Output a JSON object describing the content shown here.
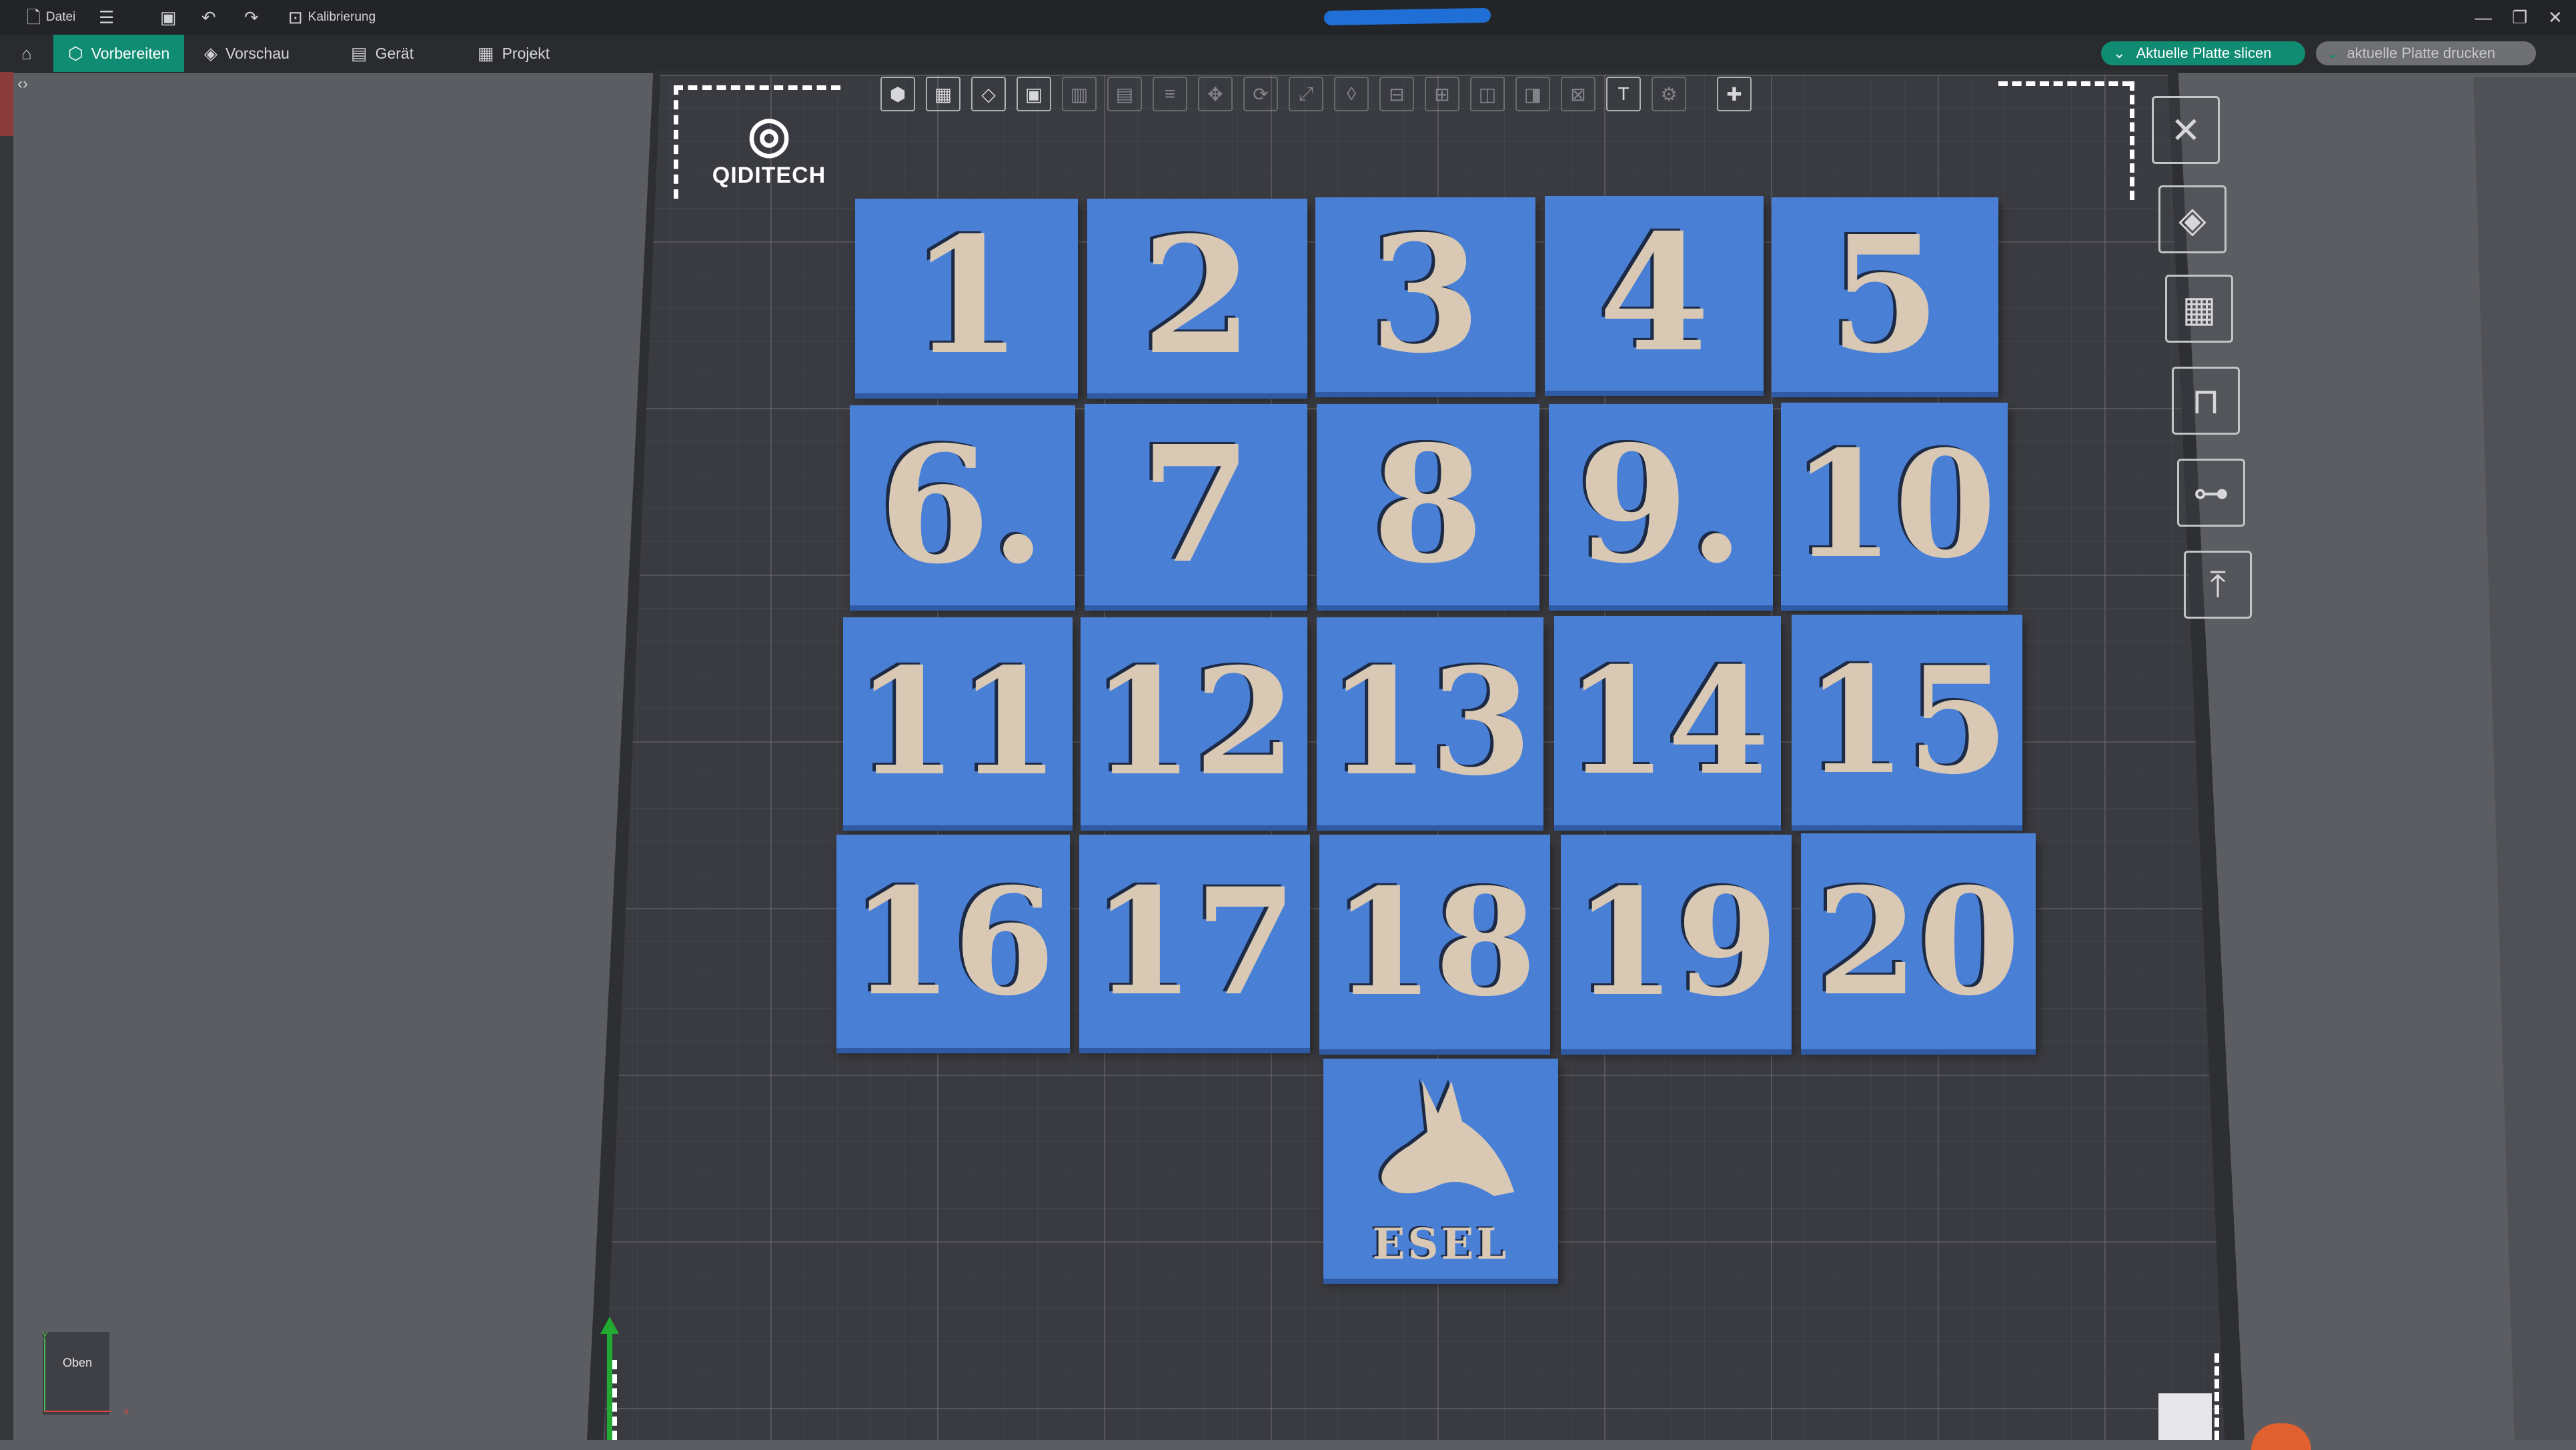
{
  "titlebar": {
    "file_label": "Datei",
    "calibration_label": "Kalibrierung",
    "icons": [
      "file-icon",
      "list-icon",
      "save-icon",
      "undo-icon",
      "redo-icon",
      "calibration-icon"
    ],
    "window_controls": [
      "minimize-icon",
      "restore-icon",
      "close-icon"
    ]
  },
  "menubar": {
    "tabs": [
      {
        "label": "Vorbereiten",
        "icon": "cube-icon",
        "active": true
      },
      {
        "label": "Vorschau",
        "icon": "layers-icon",
        "active": false
      },
      {
        "label": "Gerät",
        "icon": "device-icon",
        "active": false
      },
      {
        "label": "Projekt",
        "icon": "project-icon",
        "active": false
      }
    ],
    "slice_button": "Aktuelle Platte slicen",
    "print_button": "aktuelle Platte drucken"
  },
  "plate": {
    "logo_text": "QIDITECH",
    "tiles": [
      "1",
      "2",
      "3",
      "4",
      "5",
      "6.",
      "7",
      "8",
      "9.",
      "10",
      "11",
      "12",
      "13",
      "14",
      "15",
      "16",
      "17",
      "18",
      "19",
      "20"
    ],
    "esel_label": "ESEL"
  },
  "navcube": {
    "face_label": "Oben",
    "axis_y": "y",
    "axis_x": "x"
  },
  "colors": {
    "accent": "#0f8c72",
    "tile": "#4a7fd6",
    "glyph": "#d9c9b4",
    "plate": "#3a3b40"
  }
}
